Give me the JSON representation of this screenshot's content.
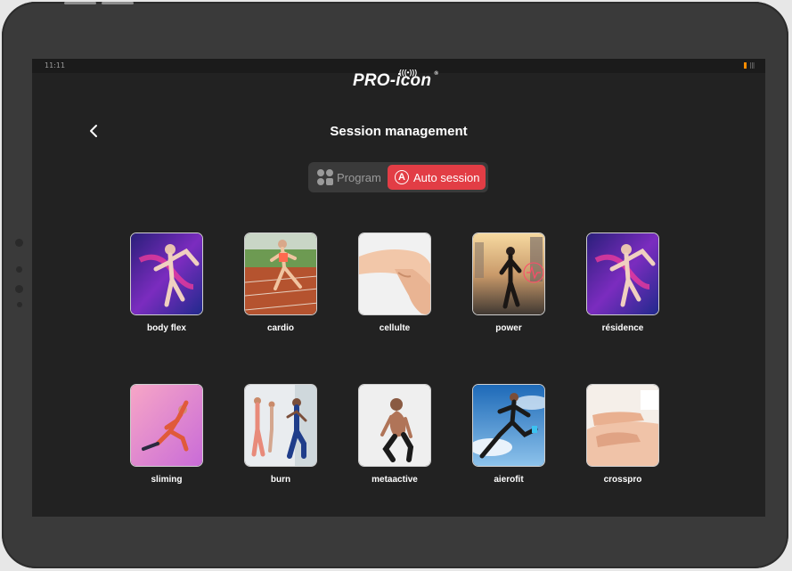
{
  "device": {
    "status_left": "11:11",
    "status_right": "|||"
  },
  "logo": {
    "text": "PRO-icon",
    "signal": "(((•)))",
    "reg": "®"
  },
  "header": {
    "title": "Session management",
    "back_icon": "chevron-left-icon"
  },
  "toggle": {
    "program_label": "Program",
    "auto_label": "Auto session",
    "active": "auto",
    "accent": "#e23d45"
  },
  "sessions": [
    {
      "label": "body flex",
      "image": "purple-stretch"
    },
    {
      "label": "cardio",
      "image": "track-runner"
    },
    {
      "label": "cellulte",
      "image": "arm-skin"
    },
    {
      "label": "power",
      "image": "city-runner"
    },
    {
      "label": "résidence",
      "image": "purple-stretch"
    },
    {
      "label": "sliming",
      "image": "pink-lunge"
    },
    {
      "label": "burn",
      "image": "gym-group"
    },
    {
      "label": "metaactive",
      "image": "crouch-man"
    },
    {
      "label": "aierofit",
      "image": "sky-jumper"
    },
    {
      "label": "crosspro",
      "image": "massage"
    }
  ]
}
